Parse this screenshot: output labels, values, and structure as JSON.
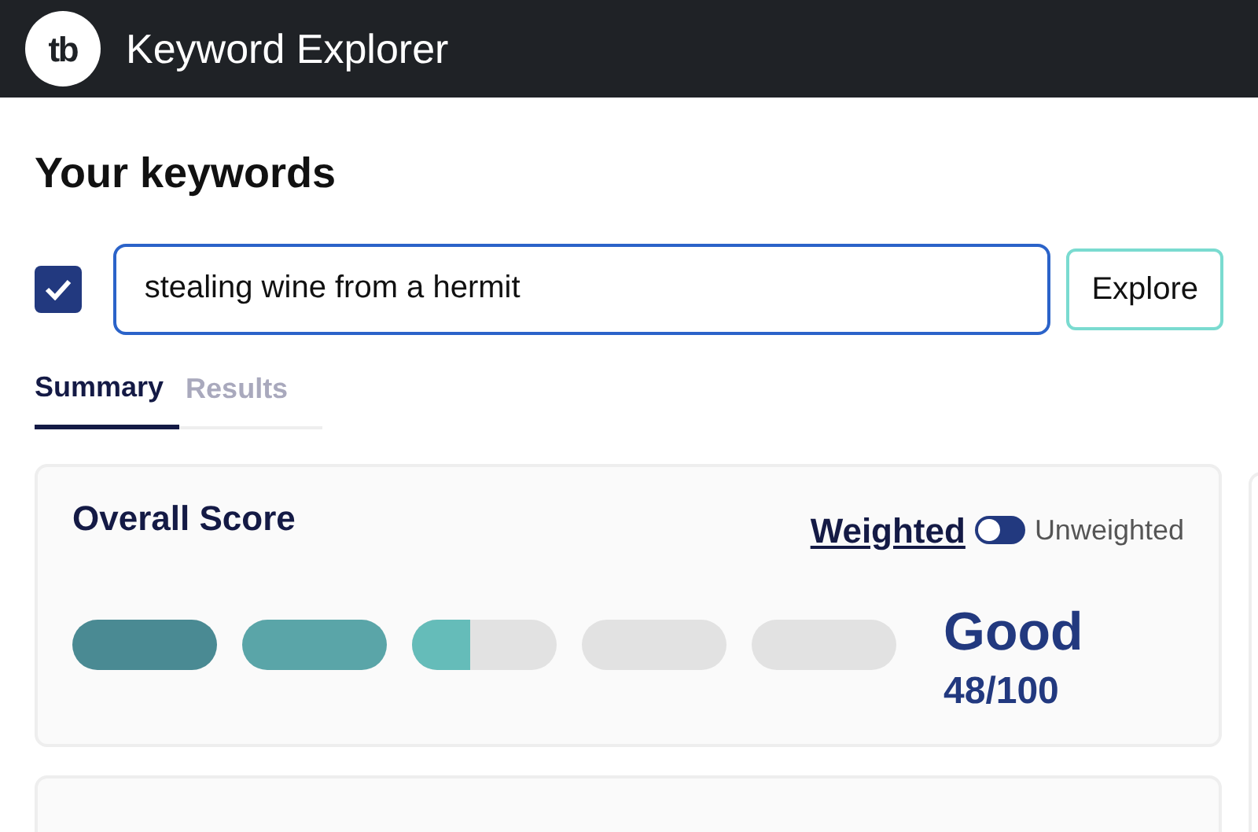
{
  "header": {
    "title": "Keyword Explorer",
    "logo": "tb"
  },
  "section_title": "Your keywords",
  "keyword": {
    "checked": true,
    "value": "stealing wine from a hermit"
  },
  "explore_button": "Explore",
  "tabs": [
    {
      "label": "Summary",
      "selected": true
    },
    {
      "label": "Results",
      "selected": false
    }
  ],
  "overall_score": {
    "title": "Overall Score",
    "weighted": true,
    "toggle_on": false,
    "weighted_label": "Weighted",
    "unweighted_label": "Unweighted",
    "segments": [
      {
        "level": 1
      },
      {
        "level": 1
      },
      {
        "level": 0.4
      },
      {
        "level": 0
      },
      {
        "level": 0
      }
    ],
    "rating": "Good",
    "score": "48/100"
  }
}
